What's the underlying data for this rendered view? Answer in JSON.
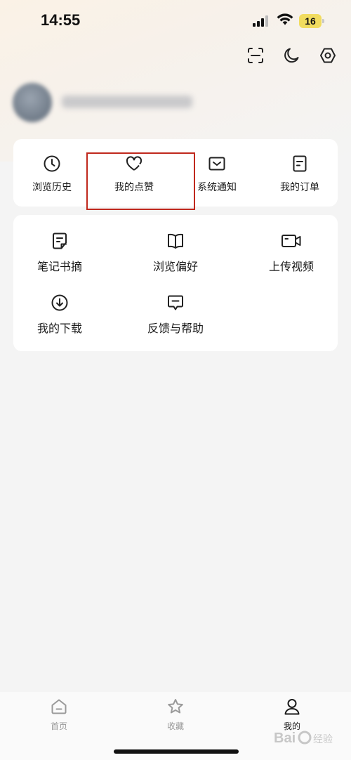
{
  "status_bar": {
    "time": "14:55",
    "battery": "16"
  },
  "header_icons": [
    {
      "icon": "scan-icon"
    },
    {
      "icon": "moon-icon"
    },
    {
      "icon": "settings-icon"
    }
  ],
  "quick_menu": {
    "items": [
      {
        "label": "浏览历史",
        "icon": "clock-icon"
      },
      {
        "label": "我的点赞",
        "icon": "heart-icon"
      },
      {
        "label": "系统通知",
        "icon": "mail-icon"
      },
      {
        "label": "我的订单",
        "icon": "order-icon"
      }
    ]
  },
  "tools_menu": {
    "items": [
      {
        "label": "笔记书摘",
        "icon": "note-icon"
      },
      {
        "label": "浏览偏好",
        "icon": "book-icon"
      },
      {
        "label": "上传视频",
        "icon": "video-camera-icon"
      },
      {
        "label": "我的下载",
        "icon": "download-icon"
      },
      {
        "label": "反馈与帮助",
        "icon": "feedback-icon"
      }
    ]
  },
  "tabbar": {
    "tabs": [
      {
        "label": "首页",
        "icon": "home-icon",
        "active": false
      },
      {
        "label": "收藏",
        "icon": "star-icon",
        "active": false
      },
      {
        "label": "我的",
        "icon": "person-icon",
        "active": true
      }
    ]
  },
  "colors": {
    "highlight_border": "#c0281d",
    "battery": "#f1dc5f",
    "background": "#f4f4f4"
  }
}
